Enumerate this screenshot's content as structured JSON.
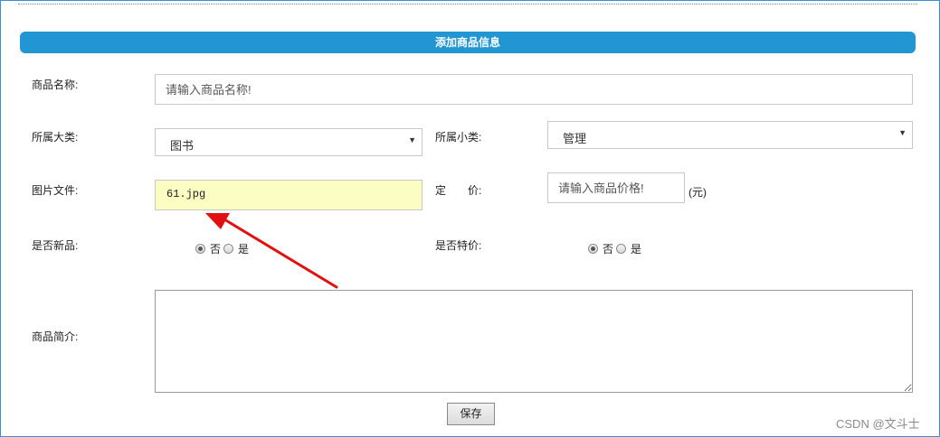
{
  "form": {
    "title": "添加商品信息",
    "name": {
      "label": "商品名称:",
      "placeholder": "请输入商品名称!"
    },
    "category": {
      "label": "所属大类:",
      "value": "图书"
    },
    "subcategory": {
      "label": "所属小类:",
      "value": "管理"
    },
    "image": {
      "label": "图片文件:",
      "value": "61.jpg"
    },
    "price": {
      "label": "定　　价:",
      "placeholder": "请输入商品价格!",
      "unit": "(元)"
    },
    "is_new": {
      "label": "是否新品:",
      "options": [
        "否",
        "是"
      ],
      "selected": "否"
    },
    "is_special": {
      "label": "是否特价:",
      "options": [
        "否",
        "是"
      ],
      "selected": "否"
    },
    "intro": {
      "label": "商品简介:"
    },
    "save_label": "保存"
  },
  "annotation": {
    "arrow_color": "#e01010"
  },
  "watermark": "CSDN @文斗士",
  "colors": {
    "title_bar": "#2196d2",
    "file_bg": "#fbfdc2"
  }
}
